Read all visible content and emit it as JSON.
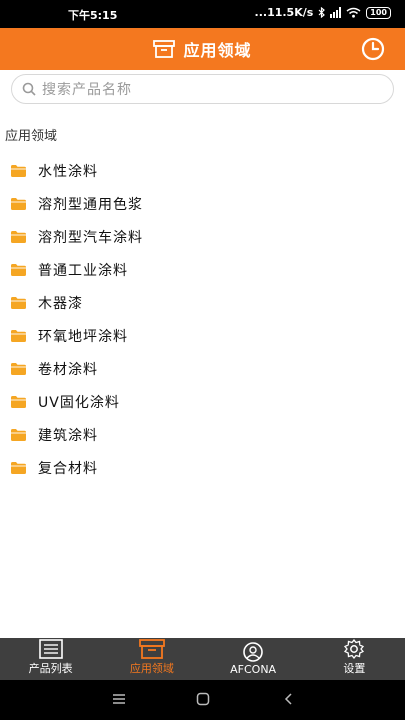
{
  "status_bar": {
    "time": "下午5:15",
    "network_speed": "...11.5K/s",
    "battery": "100"
  },
  "header": {
    "title": "应用领域",
    "icons": [
      "box-icon",
      "clock-icon"
    ]
  },
  "search": {
    "placeholder": "搜索产品名称"
  },
  "section": {
    "title": "应用领域"
  },
  "categories": [
    "水性涂料",
    "溶剂型通用色浆",
    "溶剂型汽车涂料",
    "普通工业涂料",
    "木器漆",
    "环氧地坪涂料",
    "卷材涂料",
    "UV固化涂料",
    "建筑涂料",
    "复合材料"
  ],
  "tabs": [
    {
      "label": "产品列表",
      "icon": "list-icon"
    },
    {
      "label": "应用领域",
      "icon": "box-icon",
      "active": true
    },
    {
      "label": "AFCONA",
      "icon": "logo-icon"
    },
    {
      "label": "设置",
      "icon": "gear-icon"
    }
  ],
  "colors": {
    "accent": "#f4781f",
    "folder": "#f5a623",
    "tab_bar": "#3f3f3f"
  }
}
